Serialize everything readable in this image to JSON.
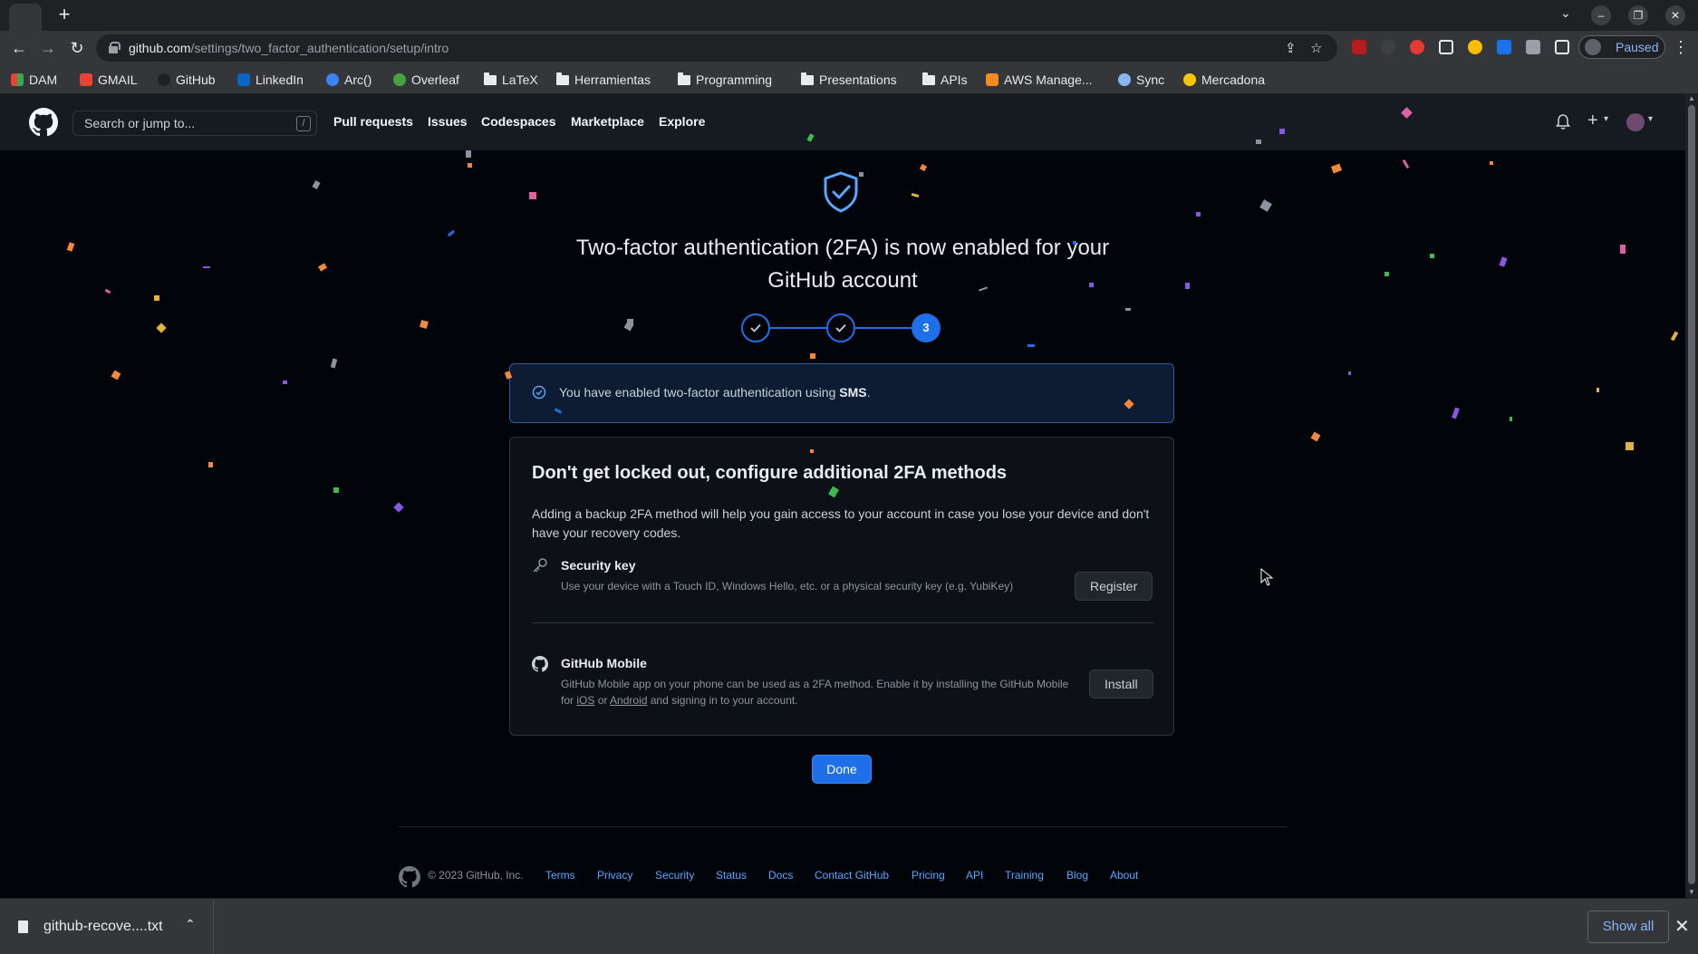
{
  "browser": {
    "url_host": "github.com",
    "url_path": "/settings/two_factor_authentication/setup/intro",
    "profile_status": "Paused",
    "window_controls": [
      "minimize-icon",
      "restore-icon",
      "close-icon"
    ],
    "bookmarks": [
      {
        "label": "DAM",
        "icon": "grid-app-icon"
      },
      {
        "label": "GMAIL",
        "icon": "gmail-icon"
      },
      {
        "label": "GitHub",
        "icon": "github-icon"
      },
      {
        "label": "LinkedIn",
        "icon": "linkedin-icon"
      },
      {
        "label": "Arc()",
        "icon": "arc-icon"
      },
      {
        "label": "Overleaf",
        "icon": "overleaf-icon"
      },
      {
        "label": "LaTeX",
        "icon": "folder-icon"
      },
      {
        "label": "Herramientas",
        "icon": "folder-icon"
      },
      {
        "label": "Programming",
        "icon": "folder-icon"
      },
      {
        "label": "Presentations",
        "icon": "folder-icon"
      },
      {
        "label": "APIs",
        "icon": "folder-icon"
      },
      {
        "label": "AWS Manage...",
        "icon": "aws-icon"
      },
      {
        "label": "Sync",
        "icon": "sync-icon"
      },
      {
        "label": "Mercadona",
        "icon": "mercadona-icon"
      }
    ]
  },
  "header": {
    "search_placeholder": "Search or jump to...",
    "search_shortcut": "/",
    "nav": [
      "Pull requests",
      "Issues",
      "Codespaces",
      "Marketplace",
      "Explore"
    ]
  },
  "main": {
    "headline": "Two-factor authentication (2FA) is now enabled for your GitHub account",
    "steps": [
      {
        "state": "complete",
        "label": ""
      },
      {
        "state": "complete",
        "label": ""
      },
      {
        "state": "current",
        "label": "3"
      }
    ],
    "flash": {
      "text_prefix": "You have enabled two-factor authentication using ",
      "method": "SMS",
      "text_suffix": "."
    },
    "box": {
      "title": "Don't get locked out, configure additional 2FA methods",
      "description": "Adding a backup 2FA method will help you gain access to your account in case you lose your device and don't have your recovery codes.",
      "methods": [
        {
          "title": "Security key",
          "description": "Use your device with a Touch ID, Windows Hello, etc. or a physical security key (e.g. YubiKey)",
          "button": "Register"
        },
        {
          "title": "GitHub Mobile",
          "description_prefix": "GitHub Mobile app on your phone can be used as a 2FA method. Enable it by installing the GitHub Mobile for ",
          "link_ios": "iOS",
          "connector": " or ",
          "link_android": "Android",
          "description_suffix": " and signing in to your account.",
          "button": "Install"
        }
      ]
    },
    "done_button": "Done"
  },
  "footer": {
    "copyright": "© 2023 GitHub, Inc.",
    "links": [
      "Terms",
      "Privacy",
      "Security",
      "Status",
      "Docs",
      "Contact GitHub",
      "Pricing",
      "API",
      "Training",
      "Blog",
      "About"
    ]
  },
  "download_shelf": {
    "filename": "github-recove....txt",
    "show_all": "Show all"
  },
  "colors": {
    "accent": "#1f6feb",
    "page_bg": "#010409",
    "header_bg": "#161b22"
  }
}
